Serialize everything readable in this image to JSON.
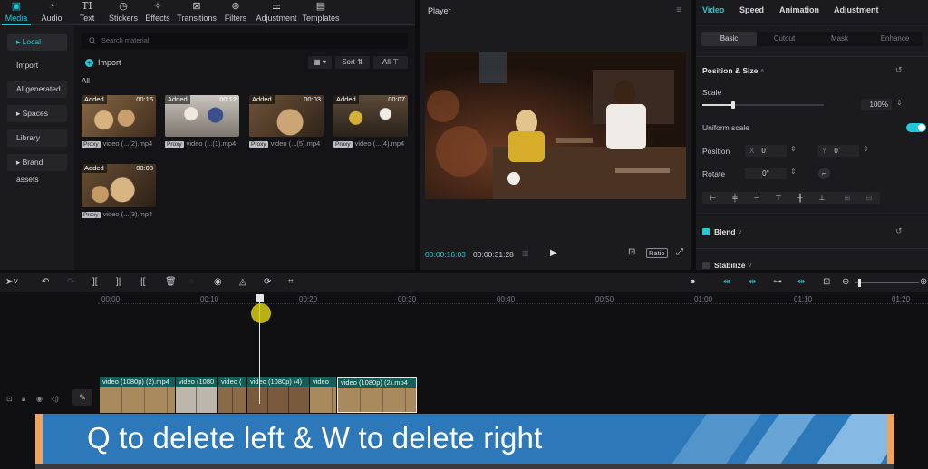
{
  "colors": {
    "accent": "#22c8d6",
    "banner_bg": "#2c78b8",
    "banner_edge": "#f0a35c",
    "clip_bg": "#155e57",
    "cursor": "#d7cd14"
  },
  "toolbar": {
    "items": [
      {
        "label": "Media",
        "icon": "media-icon"
      },
      {
        "label": "Audio",
        "icon": "audio-icon"
      },
      {
        "label": "Text",
        "icon": "text-icon"
      },
      {
        "label": "Stickers",
        "icon": "stickers-icon"
      },
      {
        "label": "Effects",
        "icon": "effects-icon"
      },
      {
        "label": "Transitions",
        "icon": "transitions-icon"
      },
      {
        "label": "Filters",
        "icon": "filters-icon"
      },
      {
        "label": "Adjustment",
        "icon": "adjustment-icon"
      },
      {
        "label": "Templates",
        "icon": "templates-icon"
      }
    ]
  },
  "sidebar": {
    "items": [
      {
        "label": "Local"
      },
      {
        "label": "Import"
      },
      {
        "label": "AI generated"
      },
      {
        "label": "Spaces"
      },
      {
        "label": "Library"
      },
      {
        "label": "Brand assets"
      }
    ]
  },
  "media": {
    "search_placeholder": "Search material",
    "import_label": "Import",
    "sort_label": "Sort",
    "all_filter": "All",
    "section_label": "All",
    "clips": [
      {
        "badge": "Added",
        "duration": "00:16",
        "proxy": "Proxy",
        "name": "video (...(2).mp4"
      },
      {
        "badge": "Added",
        "duration": "00:12",
        "proxy": "Proxy",
        "name": "video (...(1).mp4"
      },
      {
        "badge": "Added",
        "duration": "00:03",
        "proxy": "Proxy",
        "name": "video (...(5).mp4"
      },
      {
        "badge": "Added",
        "duration": "00:07",
        "proxy": "Proxy",
        "name": "video (...(4).mp4"
      },
      {
        "badge": "Added",
        "duration": "00:03",
        "proxy": "Proxy",
        "name": "video (...(3).mp4"
      }
    ]
  },
  "player": {
    "title": "Player",
    "current_time": "00:00:16:03",
    "total_time": "00:00:31:28",
    "ratio_label": "Ratio"
  },
  "inspector": {
    "tabs": [
      "Video",
      "Speed",
      "Animation",
      "Adjustment"
    ],
    "subtabs": [
      "Basic",
      "Cutout",
      "Mask",
      "Enhance"
    ],
    "section_title": "Position & Size",
    "scale_label": "Scale",
    "scale_value": "100%",
    "scale_level": 0.25,
    "uniform_scale_label": "Uniform scale",
    "uniform_scale_on": true,
    "position_label": "Position",
    "x_prefix": "X",
    "x_value": "0",
    "y_prefix": "Y",
    "y_value": "0",
    "rotate_label": "Rotate",
    "rotate_value": "0°",
    "blend_label": "Blend",
    "blend_checked": true,
    "stabilize_label": "Stabilize",
    "stabilize_checked": false
  },
  "timeline": {
    "ticks": [
      "00:00",
      "00:10",
      "00:20",
      "00:30",
      "00:40",
      "00:50",
      "01:00",
      "01:10",
      "01:20"
    ],
    "clips": [
      {
        "name": "video (1080p) (2).mp4"
      },
      {
        "name": "video (1080"
      },
      {
        "name": "video ("
      },
      {
        "name": "video (1080p) (4)"
      },
      {
        "name": "video"
      },
      {
        "name": "video (1080p) (2).mp4"
      }
    ]
  },
  "banner": {
    "text": "Q to delete left & W to delete right"
  }
}
